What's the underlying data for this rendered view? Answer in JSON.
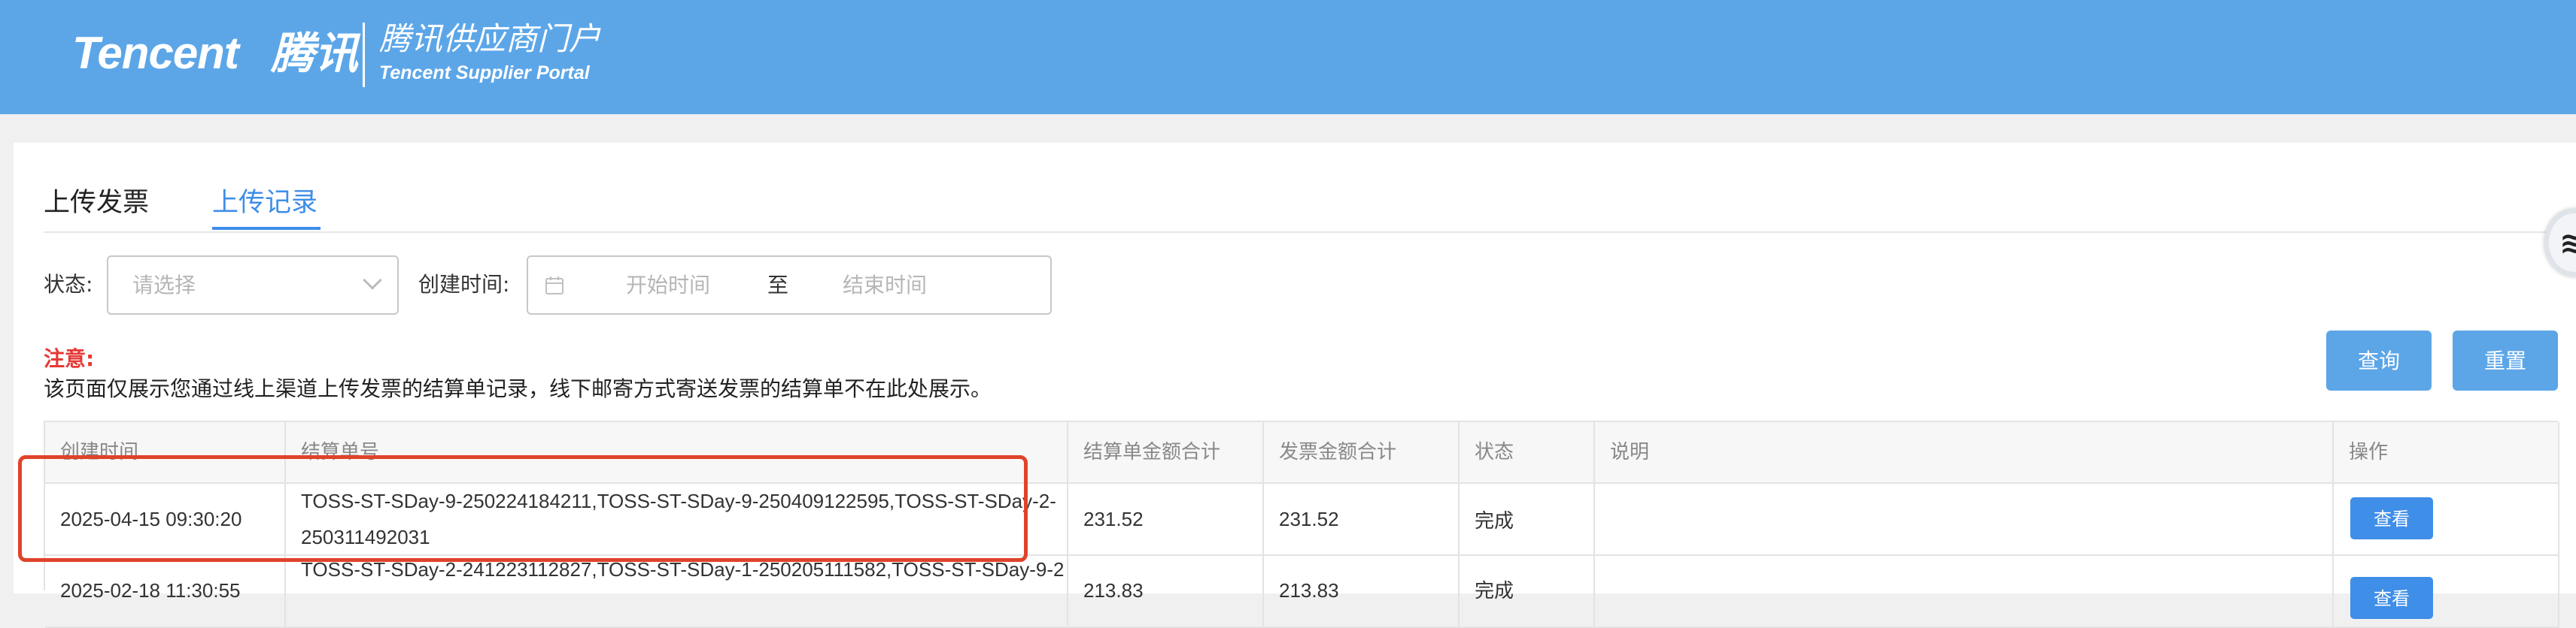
{
  "header": {
    "brand_en": "Tencent",
    "brand_cn": "腾讯",
    "portal_cn": "腾讯供应商门户",
    "portal_en": "Tencent Supplier Portal"
  },
  "tabs": [
    {
      "label": "上传发票",
      "active": false
    },
    {
      "label": "上传记录",
      "active": true
    }
  ],
  "filters": {
    "status_label": "状态:",
    "status_placeholder": "请选择",
    "created_label": "创建时间:",
    "start_placeholder": "开始时间",
    "separator": "至",
    "end_placeholder": "结束时间",
    "calendar_icon": "calendar-icon"
  },
  "notice": {
    "title": "注意:",
    "text": "该页面仅展示您通过线上渠道上传发票的结算单记录，线下邮寄方式寄送发票的结算单不在此处展示。"
  },
  "buttons": {
    "query": "查询",
    "reset": "重置"
  },
  "table": {
    "headers": [
      "创建时间",
      "结算单号",
      "结算单金额合计",
      "发票金额合计",
      "状态",
      "说明",
      "操作"
    ],
    "rows": [
      {
        "created": "2025-04-15 09:30:20",
        "settlement_no": "TOSS-ST-SDay-9-250224184211,TOSS-ST-SDay-9-250409122595,TOSS-ST-SDay-2-250311492031",
        "settlement_total": "231.52",
        "invoice_total": "231.52",
        "status": "完成",
        "note": "",
        "action": "查看"
      },
      {
        "created": "2025-02-18 11:30:55",
        "settlement_no": "TOSS-ST-SDay-2-241223112827,TOSS-ST-SDay-1-250205111582,TOSS-ST-SDay-9-2",
        "settlement_total": "213.83",
        "invoice_total": "213.83",
        "status": "完成",
        "note": "",
        "action": "查看"
      }
    ]
  },
  "colors": {
    "header_bg": "#5ca6e8",
    "accent": "#3f8ee8",
    "warning": "#e53935",
    "highlight_border": "#e0432a"
  }
}
